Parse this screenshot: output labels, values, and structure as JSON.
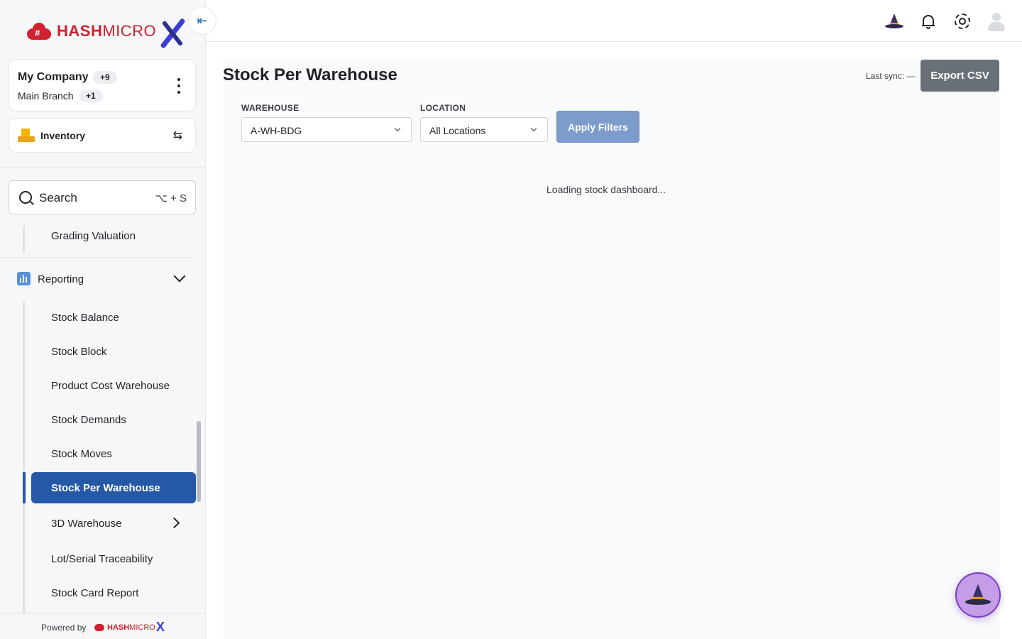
{
  "brand": {
    "name_bold": "HASH",
    "name_light": "MICRO",
    "name_x": "X"
  },
  "sidebar": {
    "company": {
      "name": "My Company",
      "badge": "+9",
      "branch": "Main Branch",
      "branch_badge": "+1"
    },
    "module": {
      "label": "Inventory"
    },
    "search": {
      "label": "Search",
      "shortcut": "⌥ + S"
    },
    "items_above": [
      {
        "label": "Grading Valuation"
      }
    ],
    "section": {
      "label": "Reporting"
    },
    "items": [
      {
        "label": "Stock Balance"
      },
      {
        "label": "Stock Block"
      },
      {
        "label": "Product Cost Warehouse"
      },
      {
        "label": "Stock Demands"
      },
      {
        "label": "Stock Moves"
      },
      {
        "label": "Stock Per Warehouse",
        "active": true
      },
      {
        "label": "3D Warehouse"
      },
      {
        "label": "Lot/Serial Traceability"
      },
      {
        "label": "Stock Card Report"
      }
    ],
    "footer": {
      "powered_by": "Powered by",
      "logo_bold": "HASH",
      "logo_light": "MICRO",
      "logo_x": "X"
    }
  },
  "topbar": {
    "icons": [
      "wizard-hat-icon",
      "bell-icon",
      "gear-icon",
      "avatar"
    ]
  },
  "main": {
    "title": "Stock Per Warehouse",
    "last_sync_label": "Last sync: —",
    "export_label": "Export CSV",
    "filters": {
      "warehouse_label": "WAREHOUSE",
      "warehouse_value": "A-WH-BDG",
      "location_label": "LOCATION",
      "location_value": "All Locations",
      "apply_label": "Apply Filters"
    },
    "loading_text": "Loading stock dashboard..."
  },
  "colors": {
    "accent": "#2559a7",
    "brand_red": "#d1202f",
    "brand_blue": "#3b3fd1",
    "export_bg": "#6a7078",
    "apply_bg": "#7d9ccc"
  }
}
